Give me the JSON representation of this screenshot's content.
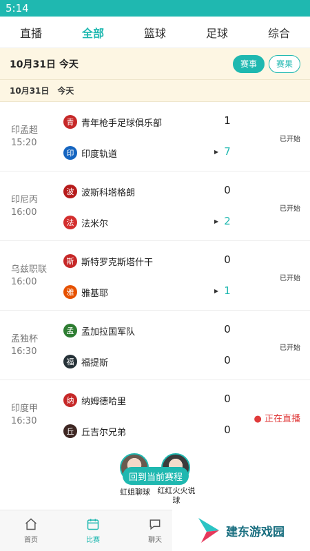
{
  "status_bar": {
    "time": "5:14"
  },
  "top_tabs": [
    {
      "label": "直播",
      "active": false
    },
    {
      "label": "全部",
      "active": true
    },
    {
      "label": "篮球",
      "active": false
    },
    {
      "label": "足球",
      "active": false
    },
    {
      "label": "综合",
      "active": false
    }
  ],
  "date_header": {
    "date": "10月31日 今天",
    "btn_events": "赛事",
    "btn_results": "赛果"
  },
  "date_sub": "10月31日　今天",
  "matches": [
    {
      "league": "印孟超",
      "time": "15:20",
      "home": "青年枪手足球俱乐部",
      "home_logo": "青",
      "home_color": "#c62828",
      "away": "印度轨道",
      "away_logo": "印",
      "away_color": "#1565c0",
      "home_score": "1",
      "away_score": "7",
      "status": "已开始"
    },
    {
      "league": "印尼丙",
      "time": "16:00",
      "home": "波斯科塔格朗",
      "home_logo": "波",
      "home_color": "#b71c1c",
      "away": "法米尔",
      "away_logo": "法",
      "away_color": "#d32f2f",
      "home_score": "0",
      "away_score": "2",
      "status": "已开始"
    },
    {
      "league": "乌兹职联",
      "time": "16:00",
      "home": "斯特罗克斯塔什干",
      "home_logo": "斯",
      "home_color": "#c62828",
      "away": "雅基耶",
      "away_logo": "雅",
      "away_color": "#e65100",
      "home_score": "0",
      "away_score": "1",
      "status": "已开始"
    },
    {
      "league": "孟独杯",
      "time": "16:30",
      "home": "孟加拉国军队",
      "home_logo": "孟",
      "home_color": "#2e7d32",
      "away": "福提斯",
      "away_logo": "福",
      "away_color": "#263238",
      "home_score": "0",
      "away_score": "0",
      "status": "已开始"
    },
    {
      "league": "印度甲",
      "time": "16:30",
      "home": "纳姆德哈里",
      "home_logo": "纳",
      "home_color": "#c62828",
      "away": "丘吉尔兄弟",
      "away_logo": "丘",
      "away_color": "#3e2723",
      "home_score": "0",
      "away_score": "0",
      "status": "正在直播"
    }
  ],
  "floating": {
    "back_button": "回到当前赛程",
    "anchor1": "虹姐聊球",
    "anchor2": "红红火火说球"
  },
  "bottom_nav": [
    {
      "label": "首页",
      "icon": "home-icon",
      "active": false
    },
    {
      "label": "比赛",
      "icon": "calendar-icon",
      "active": true
    },
    {
      "label": "聊天",
      "icon": "chat-icon",
      "active": false
    }
  ],
  "watermark": {
    "text": "建东游戏园"
  },
  "colors": {
    "accent": "#1fb8b0",
    "live": "#e03b3b",
    "header_bg": "#fdf6e3"
  }
}
